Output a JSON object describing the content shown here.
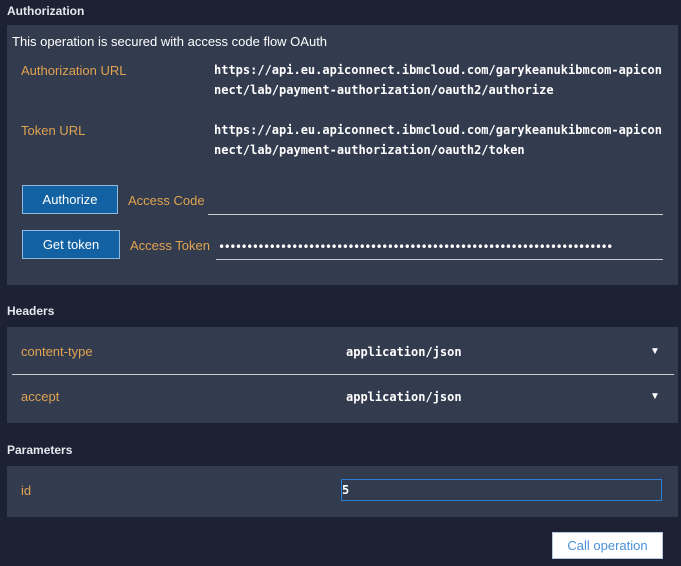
{
  "authorization": {
    "section_title": "Authorization",
    "intro": "This operation is secured with access code flow OAuth",
    "auth_url_label": "Authorization URL",
    "auth_url_line1": "https://api.eu.apiconnect.ibmcloud.com/garykeanukibmcom-apicon",
    "auth_url_line2": "nect/lab/payment-authorization/oauth2/authorize",
    "token_url_label": "Token URL",
    "token_url_line1": "https://api.eu.apiconnect.ibmcloud.com/garykeanukibmcom-apicon",
    "token_url_line2": "nect/lab/payment-authorization/oauth2/token",
    "authorize_button": "Authorize",
    "access_code_label": "Access Code",
    "access_code_value": "",
    "get_token_button": "Get token",
    "access_token_label": "Access Token",
    "access_token_masked": "••••••••••••••••••••••••••••••••••••••••••••••••••••••••••••••••••••••"
  },
  "headers": {
    "section_title": "Headers",
    "rows": [
      {
        "name": "content-type",
        "value": "application/json"
      },
      {
        "name": "accept",
        "value": "application/json"
      }
    ],
    "dropdown_glyph": "▼"
  },
  "parameters": {
    "section_title": "Parameters",
    "id_label": "id",
    "id_value": "5"
  },
  "call_button": "Call operation",
  "colors": {
    "background": "#1c2233",
    "panel": "#333b4e",
    "label_orange": "#e0a350",
    "button_blue": "#1262a3",
    "focus_blue": "#2b7fd8"
  }
}
